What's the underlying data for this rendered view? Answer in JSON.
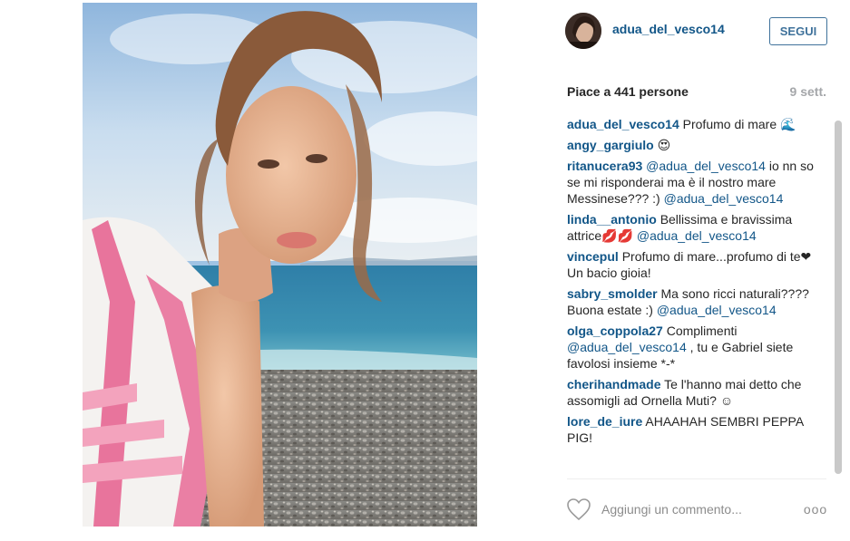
{
  "post": {
    "username": "adua_del_vesco14",
    "follow_label": "SEGUI",
    "likes_text": "Piace a 441 persone",
    "age": "9 sett.",
    "comment_placeholder": "Aggiungi un commento...",
    "more_label": "ooo",
    "heart_icon": "heart-outline-icon"
  },
  "colors": {
    "link": "#125688",
    "follow_border": "#3f729b",
    "muted": "#a5a7aa"
  },
  "comments": [
    {
      "author": "adua_del_vesco14",
      "parts": [
        {
          "t": "Profumo di mare 🌊"
        }
      ]
    },
    {
      "author": "angy_gargiulo",
      "parts": [
        {
          "t": "😍"
        }
      ]
    },
    {
      "author": "ritanucera93",
      "parts": [
        {
          "m": "@adua_del_vesco14"
        },
        {
          "t": " io nn so se mi risponderai ma è il nostro mare Messinese??? :) "
        },
        {
          "m": "@adua_del_vesco14"
        }
      ]
    },
    {
      "author": "linda__antonio",
      "parts": [
        {
          "t": "Bellissima e bravissima attrice💋💋 "
        },
        {
          "m": "@adua_del_vesco14"
        }
      ]
    },
    {
      "author": "vincepul",
      "parts": [
        {
          "t": "Profumo di mare...profumo di te❤Un bacio gioia!"
        }
      ]
    },
    {
      "author": "sabry_smolder",
      "parts": [
        {
          "t": "Ma sono ricci naturali???? Buona estate :) "
        },
        {
          "m": "@adua_del_vesco14"
        }
      ]
    },
    {
      "author": "olga_coppola27",
      "parts": [
        {
          "t": "Complimenti "
        },
        {
          "m": "@adua_del_vesco14"
        },
        {
          "t": " , tu e Gabriel siete favolosi insieme *-*"
        }
      ]
    },
    {
      "author": "cherihandmade",
      "parts": [
        {
          "t": "Te l'hanno mai detto che assomigli ad Ornella Muti? ☺"
        }
      ]
    },
    {
      "author": "lore_de_iure",
      "parts": [
        {
          "t": "AHAAHAH SEMBRI PEPPA PIG!"
        }
      ]
    }
  ]
}
